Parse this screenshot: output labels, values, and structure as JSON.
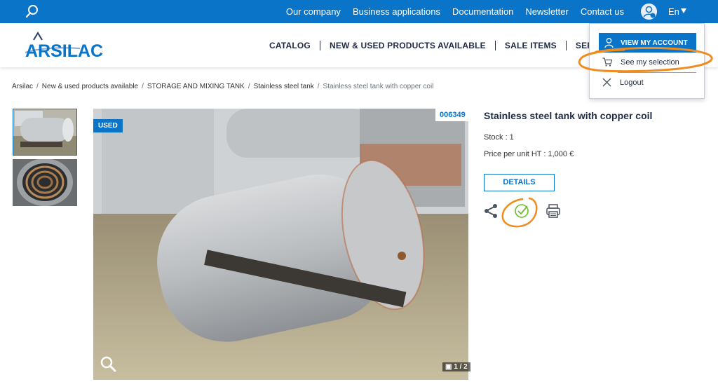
{
  "topbar": {
    "links": [
      "Our company",
      "Business applications",
      "Documentation",
      "Newsletter",
      "Contact us"
    ],
    "language": "En",
    "icons": {
      "search": "search-icon",
      "user": "user-icon",
      "caret": "caret-down-icon"
    }
  },
  "brand": {
    "name": "ARSILAC"
  },
  "mainnav": {
    "items": [
      "CATALOG",
      "NEW & USED PRODUCTS AVAILABLE",
      "SALE ITEMS",
      "SERVICES"
    ]
  },
  "breadcrumb": {
    "items": [
      "Arsilac",
      "New & used products available",
      "STORAGE AND MIXING TANK",
      "Stainless steel tank",
      "Stainless steel tank with copper coil"
    ]
  },
  "product": {
    "badge": "USED",
    "reference": "006349",
    "title": "Stainless steel tank with copper coil",
    "stock": "Stock : 1",
    "price": "Price per unit HT : 1,000 €",
    "details_label": "DETAILS",
    "image_counter": "1 / 2",
    "actions": [
      "share-icon",
      "check-icon",
      "print-icon"
    ]
  },
  "dropdown": {
    "account_label": "VIEW MY ACCOUNT",
    "selection_label": "See my selection",
    "logout_label": "Logout"
  },
  "colors": {
    "brand_blue": "#0a74c9",
    "annotation_orange": "#f08c1e",
    "text_dark": "#1f2a44"
  }
}
